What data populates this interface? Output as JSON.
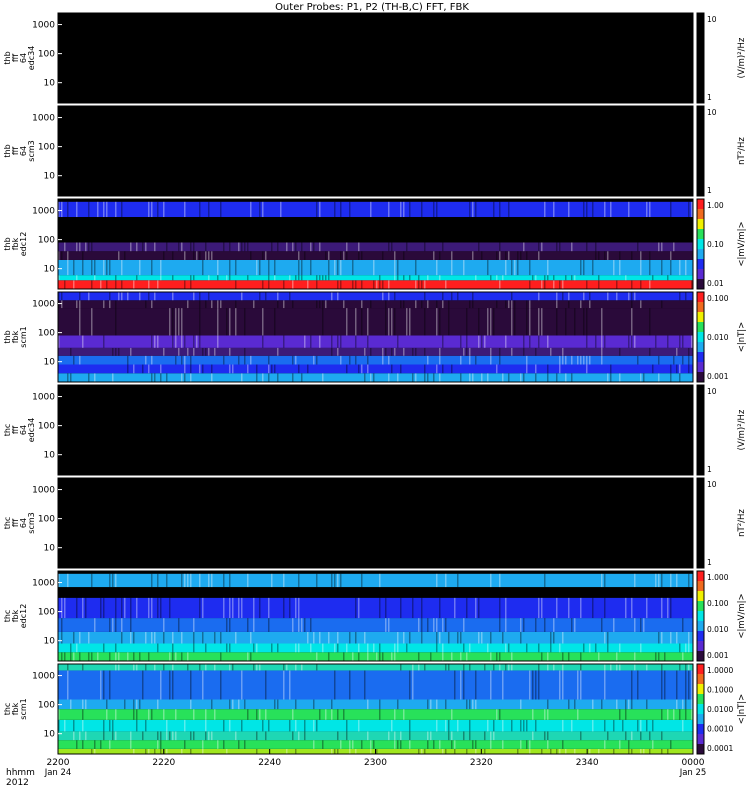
{
  "figure": {
    "title": "Outer Probes: P1, P2 (TH-B,C) FFT, FBK",
    "time_axis": {
      "row_label_1": "hhmm",
      "row_label_2": "2012",
      "ticks": [
        {
          "t": 0,
          "label": "2200",
          "sub": "Jan 24"
        },
        {
          "t": 20,
          "label": "2220",
          "sub": ""
        },
        {
          "t": 40,
          "label": "2240",
          "sub": ""
        },
        {
          "t": 60,
          "label": "2300",
          "sub": ""
        },
        {
          "t": 80,
          "label": "2320",
          "sub": ""
        },
        {
          "t": 100,
          "label": "2340",
          "sub": ""
        },
        {
          "t": 120,
          "label": "0000",
          "sub": "Jan 25"
        }
      ]
    }
  },
  "colors": {
    "black": "#000000",
    "dark_purple": "#2a0a3a",
    "purple": "#3c1a78",
    "violet": "#5a2ad2",
    "blue": "#1e2cf0",
    "mid_blue": "#1a6cf0",
    "light_blue": "#1eaaf0",
    "cyan": "#00e6e6",
    "teal": "#1ed7b4",
    "green": "#28e15a",
    "yellow_green": "#a0e61e",
    "yellow": "#f0f000",
    "orange": "#f06a1e",
    "red": "#ff1e1e"
  },
  "chart_data": [
    {
      "type": "heatmap",
      "panel_label": [
        "thb",
        "fff",
        "64",
        "edc34"
      ],
      "yticks": [
        "1000",
        "100",
        "10"
      ],
      "colorbar_label": "(V/m)²/Hz",
      "colorbar_ticks": [
        "10",
        "1"
      ],
      "colorbar_gradient": false,
      "bands": [
        {
          "from": 1,
          "to": 10000,
          "color": "black"
        }
      ]
    },
    {
      "type": "heatmap",
      "panel_label": [
        "thb",
        "fff",
        "64",
        "scm3"
      ],
      "yticks": [
        "1000",
        "100",
        "10"
      ],
      "colorbar_label": "nT²/Hz",
      "colorbar_ticks": [
        "10",
        "1"
      ],
      "colorbar_gradient": false,
      "bands": [
        {
          "from": 1,
          "to": 10000,
          "color": "black"
        }
      ]
    },
    {
      "type": "heatmap",
      "panel_label": [
        "thb",
        "fbk",
        "edc12"
      ],
      "yticks": [
        "1000",
        "100",
        "10"
      ],
      "colorbar_label": "<|mV/m|>",
      "colorbar_ticks": [
        "1.00",
        "0.10",
        "0.01"
      ],
      "colorbar_gradient": true,
      "bands": [
        {
          "from": 2,
          "to": 4,
          "color": "red"
        },
        {
          "from": 4,
          "to": 6,
          "color": "cyan"
        },
        {
          "from": 6,
          "to": 20,
          "color": "light_blue"
        },
        {
          "from": 20,
          "to": 40,
          "color": "dark_purple"
        },
        {
          "from": 40,
          "to": 80,
          "color": "purple"
        },
        {
          "from": 80,
          "to": 600,
          "color": "black"
        },
        {
          "from": 600,
          "to": 2000,
          "color": "blue"
        }
      ]
    },
    {
      "type": "heatmap",
      "panel_label": [
        "thb",
        "fbk",
        "scm1"
      ],
      "yticks": [
        "1000",
        "100",
        "10"
      ],
      "colorbar_label": "<|nT|>",
      "colorbar_ticks": [
        "0.100",
        "0.010",
        "0.001"
      ],
      "colorbar_gradient": true,
      "bands": [
        {
          "from": 2,
          "to": 4,
          "color": "light_blue"
        },
        {
          "from": 4,
          "to": 8,
          "color": "blue"
        },
        {
          "from": 8,
          "to": 16,
          "color": "mid_blue"
        },
        {
          "from": 16,
          "to": 30,
          "color": "purple"
        },
        {
          "from": 30,
          "to": 80,
          "color": "violet"
        },
        {
          "from": 80,
          "to": 700,
          "color": "dark_purple"
        },
        {
          "from": 700,
          "to": 1300,
          "color": "dark_purple"
        },
        {
          "from": 1300,
          "to": 2500,
          "color": "blue"
        }
      ]
    },
    {
      "type": "heatmap",
      "panel_label": [
        "thc",
        "fff",
        "64",
        "edc34"
      ],
      "yticks": [
        "1000",
        "100",
        "10"
      ],
      "colorbar_label": "(V/m)²/Hz",
      "colorbar_ticks": [
        "10",
        "1"
      ],
      "colorbar_gradient": false,
      "bands": [
        {
          "from": 1,
          "to": 10000,
          "color": "black"
        }
      ]
    },
    {
      "type": "heatmap",
      "panel_label": [
        "thc",
        "fff",
        "64",
        "scm3"
      ],
      "yticks": [
        "1000",
        "100",
        "10"
      ],
      "colorbar_label": "nT²/Hz",
      "colorbar_ticks": [
        "10",
        "1"
      ],
      "colorbar_gradient": false,
      "bands": [
        {
          "from": 1,
          "to": 10000,
          "color": "black"
        }
      ]
    },
    {
      "type": "heatmap",
      "panel_label": [
        "thc",
        "fbk",
        "edc12"
      ],
      "yticks": [
        "1000",
        "100",
        "10"
      ],
      "colorbar_label": "<|mV/m|>",
      "colorbar_ticks": [
        "1.000",
        "0.100",
        "0.010",
        "0.001"
      ],
      "colorbar_gradient": true,
      "bands": [
        {
          "from": 2,
          "to": 4,
          "color": "green"
        },
        {
          "from": 4,
          "to": 8,
          "color": "cyan"
        },
        {
          "from": 8,
          "to": 20,
          "color": "light_blue"
        },
        {
          "from": 20,
          "to": 60,
          "color": "mid_blue"
        },
        {
          "from": 60,
          "to": 300,
          "color": "blue"
        },
        {
          "from": 300,
          "to": 700,
          "color": "black"
        },
        {
          "from": 700,
          "to": 2000,
          "color": "light_blue"
        }
      ]
    },
    {
      "type": "heatmap",
      "panel_label": [
        "thc",
        "fbk",
        "scm1"
      ],
      "yticks": [
        "1000",
        "100",
        "10"
      ],
      "colorbar_label": "<|nT|>",
      "colorbar_ticks": [
        "1.0000",
        "0.1000",
        "0.0100",
        "0.0010",
        "0.0001"
      ],
      "colorbar_gradient": true,
      "bands": [
        {
          "from": 2,
          "to": 3,
          "color": "yellow_green"
        },
        {
          "from": 3,
          "to": 6,
          "color": "green"
        },
        {
          "from": 6,
          "to": 12,
          "color": "teal"
        },
        {
          "from": 12,
          "to": 30,
          "color": "cyan"
        },
        {
          "from": 30,
          "to": 70,
          "color": "green"
        },
        {
          "from": 70,
          "to": 150,
          "color": "light_blue"
        },
        {
          "from": 150,
          "to": 1500,
          "color": "mid_blue"
        },
        {
          "from": 1500,
          "to": 2500,
          "color": "teal"
        }
      ]
    }
  ]
}
